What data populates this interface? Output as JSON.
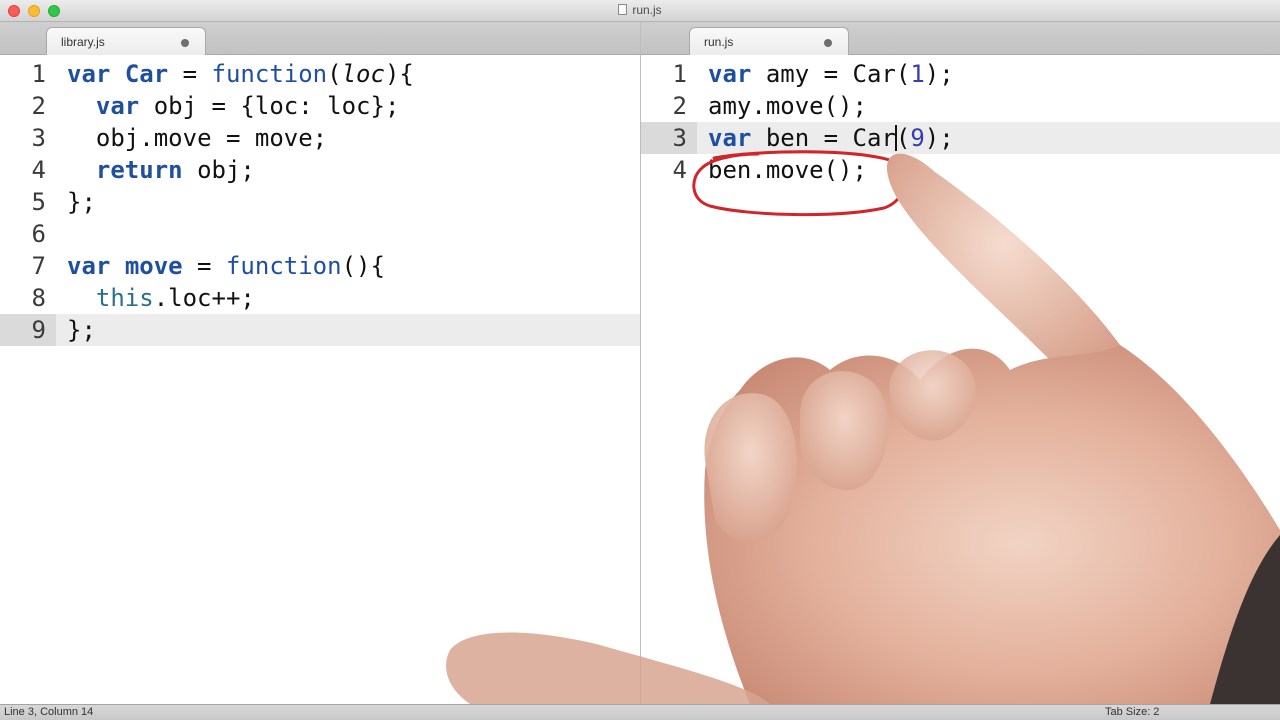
{
  "window": {
    "title": "run.js"
  },
  "left_pane": {
    "tab": "library.js",
    "current_line": 9,
    "lines": [
      {
        "n": "1"
      },
      {
        "n": "2"
      },
      {
        "n": "3"
      },
      {
        "n": "4"
      },
      {
        "n": "5"
      },
      {
        "n": "6"
      },
      {
        "n": "7"
      },
      {
        "n": "8"
      },
      {
        "n": "9"
      }
    ]
  },
  "right_pane": {
    "tab": "run.js",
    "current_line": 3,
    "lines": [
      {
        "n": "1"
      },
      {
        "n": "2"
      },
      {
        "n": "3"
      },
      {
        "n": "4"
      }
    ]
  },
  "code": {
    "var": "var",
    "function": "function",
    "return": "return",
    "this": "this",
    "Car": "Car",
    "loc": "loc",
    "move": "move",
    "obj": "obj",
    "amy": "amy",
    "ben": "ben",
    "one": "1",
    "nine": "9"
  },
  "statusbar": {
    "position": "Line 3, Column 14",
    "tab_size": "Tab Size: 2"
  },
  "colors": {
    "keyword": "#1f4fa1",
    "number": "#3b3bb0",
    "annotation": "#d0262a"
  }
}
